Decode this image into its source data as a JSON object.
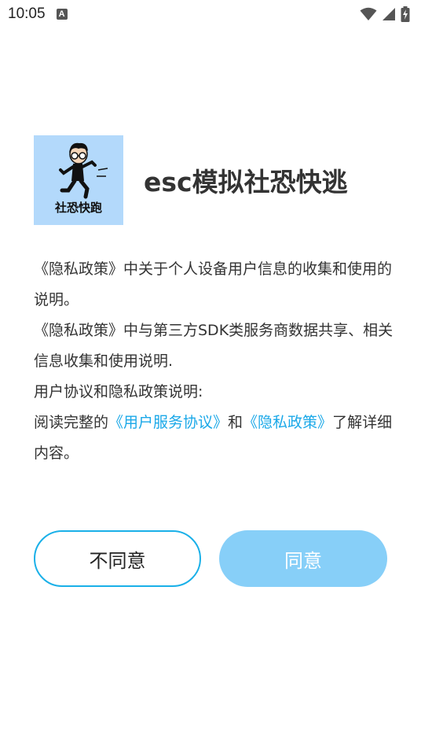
{
  "status_bar": {
    "time": "10:05",
    "notification_icon": "A"
  },
  "app": {
    "icon_label": "社恐快跑",
    "title": "esc模拟社恐快逃"
  },
  "policy": {
    "line1": "《隐私政策》中关于个人设备用户信息的收集和使用的说明。",
    "line2": "《隐私政策》中与第三方SDK类服务商数据共享、相关信息收集和使用说明.",
    "line3": "用户协议和隐私政策说明:",
    "line4_prefix": "阅读完整的",
    "link_user_agreement": "《用户服务协议》",
    "line4_and": "和",
    "link_privacy_policy": "《隐私政策》",
    "line4_suffix": "了解详细内容。"
  },
  "buttons": {
    "decline_label": "不同意",
    "agree_label": "同意"
  },
  "colors": {
    "accent": "#1aa8e8",
    "agree_button": "#87cff8",
    "icon_background": "#b3d9fb"
  }
}
